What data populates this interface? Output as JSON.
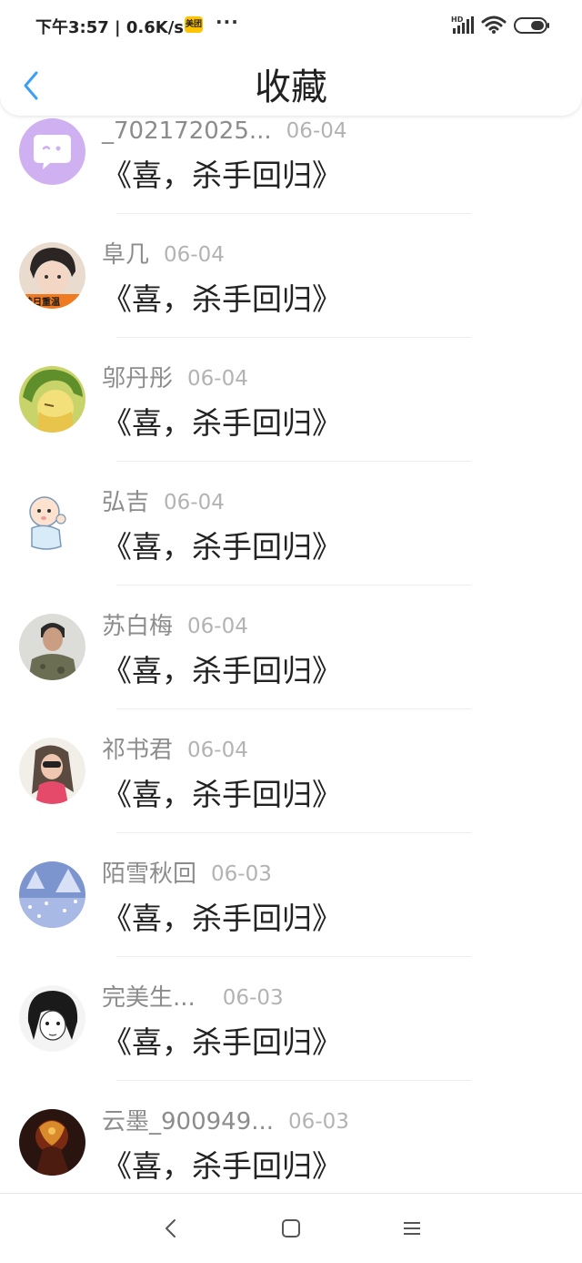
{
  "status_bar": {
    "time_speed": "下午3:57 | 0.6K/s",
    "app_badge": "美团",
    "more": "···",
    "network": "HD"
  },
  "header": {
    "title": "收藏"
  },
  "items": [
    {
      "name": "_702172025...",
      "date": "06-04",
      "content": "《喜，杀手回归》"
    },
    {
      "name": "阜几",
      "date": "06-04",
      "content": "《喜，杀手回归》",
      "avatar_caption": "昔日重温"
    },
    {
      "name": "邬丹彤",
      "date": "06-04",
      "content": "《喜，杀手回归》"
    },
    {
      "name": "弘吉",
      "date": "06-04",
      "content": "《喜，杀手回归》"
    },
    {
      "name": "苏白梅",
      "date": "06-04",
      "content": "《喜，杀手回归》"
    },
    {
      "name": "祁书君",
      "date": "06-04",
      "content": "《喜，杀手回归》"
    },
    {
      "name": "陌雪秋回",
      "date": "06-03",
      "content": "《喜，杀手回归》"
    },
    {
      "name": "完美生...",
      "date": "06-03",
      "content": "《喜，杀手回归》"
    },
    {
      "name": "云墨_900949...",
      "date": "06-03",
      "content": "《喜，杀手回归》"
    }
  ],
  "icons": {
    "back": "chevron-left-icon",
    "nav_back": "nav-back-icon",
    "nav_home": "nav-home-icon",
    "nav_menu": "nav-menu-icon"
  },
  "colors": {
    "accent": "#3a9ff5",
    "name_text": "#8c8c8c",
    "date_text": "#b3b3b3",
    "content_text": "#222222"
  }
}
